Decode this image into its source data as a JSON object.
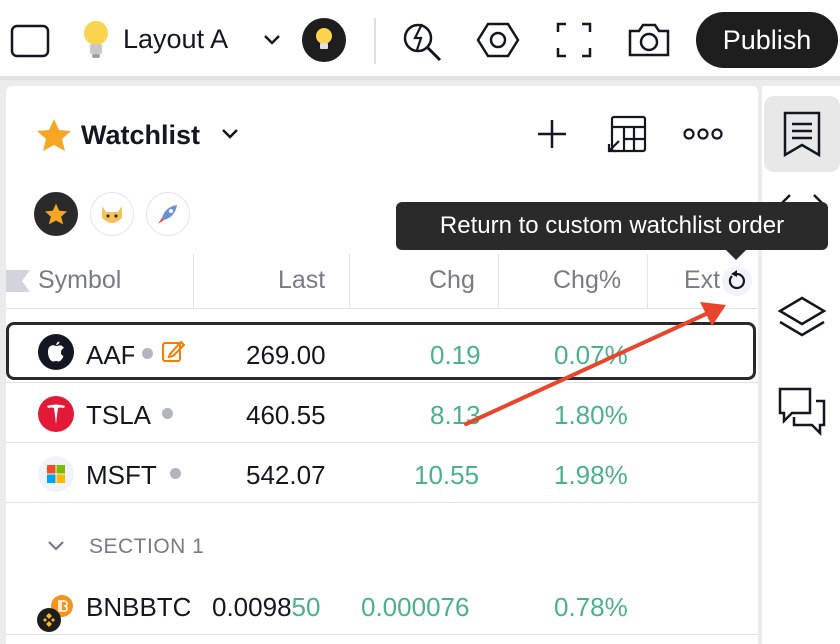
{
  "topbar": {
    "layout_name": "Layout A",
    "publish_label": "Publish"
  },
  "watchlist": {
    "title": "Watchlist",
    "columns": [
      "Symbol",
      "Last",
      "Chg",
      "Chg%",
      "Ext"
    ],
    "rows": [
      {
        "symbol": "AAF",
        "last": "269.00",
        "chg": "0.19",
        "chgp": "0.07%"
      },
      {
        "symbol": "TSLA",
        "last": "460.55",
        "chg": "8.13",
        "chgp": "1.80%"
      },
      {
        "symbol": "MSFT",
        "last": "542.07",
        "chg": "10.55",
        "chgp": "1.98%"
      }
    ],
    "section": {
      "label": "SECTION 1",
      "rows": [
        {
          "symbol": "BNBBTC",
          "last": "0.0098",
          "last_tail": "50",
          "chg": "0.000076",
          "chgp": "0.78%"
        }
      ]
    }
  },
  "tooltip": {
    "text": "Return to custom watchlist order"
  },
  "colors": {
    "accent_green": "#4caf8f",
    "annotation_red": "#e8452c",
    "star_yellow": "#f5a623"
  }
}
